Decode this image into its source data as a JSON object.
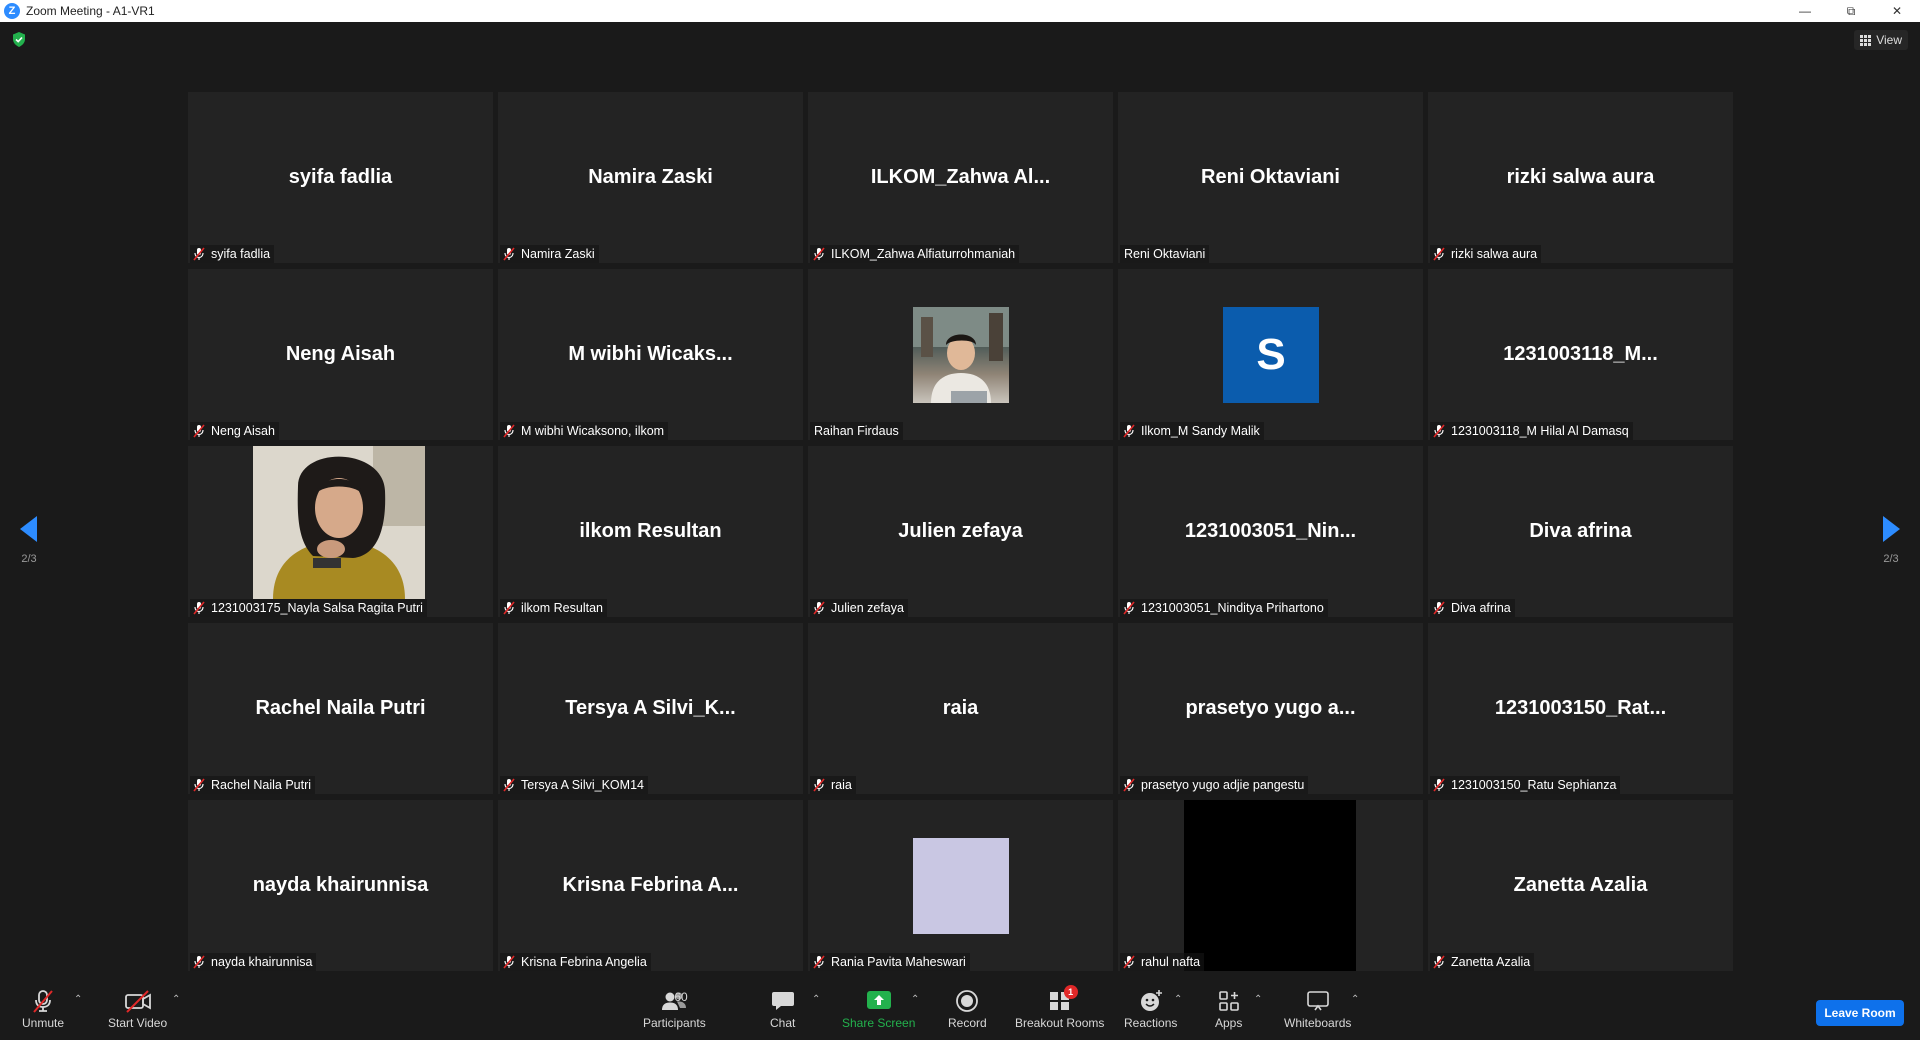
{
  "window": {
    "title": "Zoom Meeting - A1-VR1"
  },
  "top": {
    "view_label": "View"
  },
  "tiles": [
    {
      "big": "syifa fadlia",
      "label": "syifa fadlia",
      "muted": true
    },
    {
      "big": "Namira Zaski",
      "label": "Namira Zaski",
      "muted": true
    },
    {
      "big": "ILKOM_Zahwa  Al...",
      "label": "ILKOM_Zahwa Alfiaturrohmaniah",
      "muted": true
    },
    {
      "big": "Reni Oktaviani",
      "label": "Reni Oktaviani",
      "muted": false
    },
    {
      "big": "rizki salwa aura",
      "label": "rizki salwa aura",
      "muted": true
    },
    {
      "big": "Neng Aisah",
      "label": "Neng Aisah",
      "muted": true
    },
    {
      "big": "M  wibhi  Wicaks...",
      "label": "M wibhi Wicaksono, ilkom",
      "muted": true
    },
    {
      "big": "",
      "label": "Raihan Firdaus",
      "muted": false,
      "media": "photo-man"
    },
    {
      "big": "",
      "label": "Ilkom_M Sandy Malik",
      "muted": true,
      "media": "avatar-s",
      "avatar_letter": "S"
    },
    {
      "big": "1231003118_M...",
      "label": "1231003118_M Hilal Al Damasq",
      "muted": true
    },
    {
      "big": "",
      "label": "1231003175_Nayla Salsa Ragita Putri",
      "muted": true,
      "media": "photo-woman"
    },
    {
      "big": "ilkom Resultan",
      "label": "ilkom Resultan",
      "muted": true
    },
    {
      "big": "Julien zefaya",
      "label": "Julien zefaya",
      "muted": true
    },
    {
      "big": "1231003051_Nin...",
      "label": "1231003051_Ninditya Prihartono",
      "muted": true
    },
    {
      "big": "Diva afrina",
      "label": "Diva afrina",
      "muted": true
    },
    {
      "big": "Rachel Naila Putri",
      "label": "Rachel Naila Putri",
      "muted": true
    },
    {
      "big": "Tersya  A  Silvi_K...",
      "label": "Tersya A Silvi_KOM14",
      "muted": true
    },
    {
      "big": "raia",
      "label": "raia",
      "muted": true
    },
    {
      "big": "prasetyo  yugo  a...",
      "label": "prasetyo yugo adjie pangestu",
      "muted": true
    },
    {
      "big": "1231003150_Rat...",
      "label": "1231003150_Ratu Sephianza",
      "muted": true
    },
    {
      "big": "nayda khairunnisa",
      "label": "nayda khairunnisa",
      "muted": true
    },
    {
      "big": "Krisna  Febrina  A...",
      "label": "Krisna Febrina Angelia",
      "muted": true
    },
    {
      "big": "",
      "label": "Rania Pavita Maheswari",
      "muted": true,
      "media": "lavender"
    },
    {
      "big": "",
      "label": "rahul nafta",
      "muted": true,
      "media": "blackbox"
    },
    {
      "big": "Zanetta Azalia",
      "label": "Zanetta Azalia",
      "muted": true
    }
  ],
  "pager": {
    "left": "2/3",
    "right": "2/3"
  },
  "toolbar": {
    "unmute": "Unmute",
    "start_video": "Start Video",
    "participants": "Participants",
    "participants_count": "60",
    "chat": "Chat",
    "share_screen": "Share Screen",
    "record": "Record",
    "breakout_rooms": "Breakout Rooms",
    "breakout_badge": "1",
    "reactions": "Reactions",
    "apps": "Apps",
    "whiteboards": "Whiteboards",
    "leave": "Leave Room"
  },
  "colors": {
    "accent": "#0e71eb",
    "nav_arrow": "#2d8cff",
    "muted_mic": "#e02828",
    "share_green": "#23b14d"
  }
}
